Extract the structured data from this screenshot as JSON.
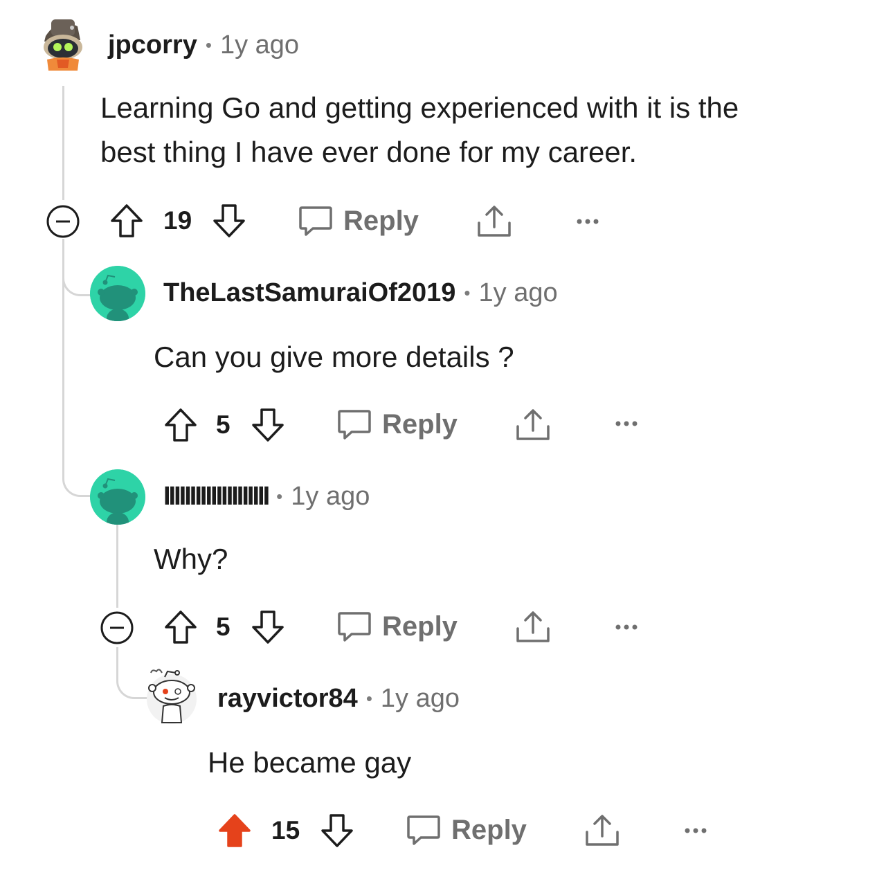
{
  "colors": {
    "upvoted": "#e5421b",
    "icon": "#1c1c1c",
    "muted": "#6f6f6f",
    "avatar_green": "#2ed3a7"
  },
  "comments": [
    {
      "username": "jpcorry",
      "separator": "•",
      "time": "1y ago",
      "text_line1": "Learning Go and getting experienced with it is the",
      "text_line2": "best thing I have ever done for my career.",
      "votes": "19",
      "reply_label": "Reply",
      "avatar_icon": "snoo-hat-avatar-icon"
    },
    {
      "username": "TheLastSamuraiOf2019",
      "separator": "•",
      "time": "1y ago",
      "text": "Can you give more details ?",
      "votes": "5",
      "reply_label": "Reply",
      "avatar_icon": "default-snoo-avatar-icon"
    },
    {
      "username": "IIIIIIIIIIIIIIIIIIII",
      "separator": "•",
      "time": "1y ago",
      "text": "Why?",
      "votes": "5",
      "reply_label": "Reply",
      "avatar_icon": "default-snoo-avatar-icon"
    },
    {
      "username": "rayvictor84",
      "separator": "•",
      "time": "1y ago",
      "text": "He became gay",
      "votes": "15",
      "upvoted": true,
      "reply_label": "Reply",
      "avatar_icon": "snoo-outline-avatar-icon"
    }
  ]
}
